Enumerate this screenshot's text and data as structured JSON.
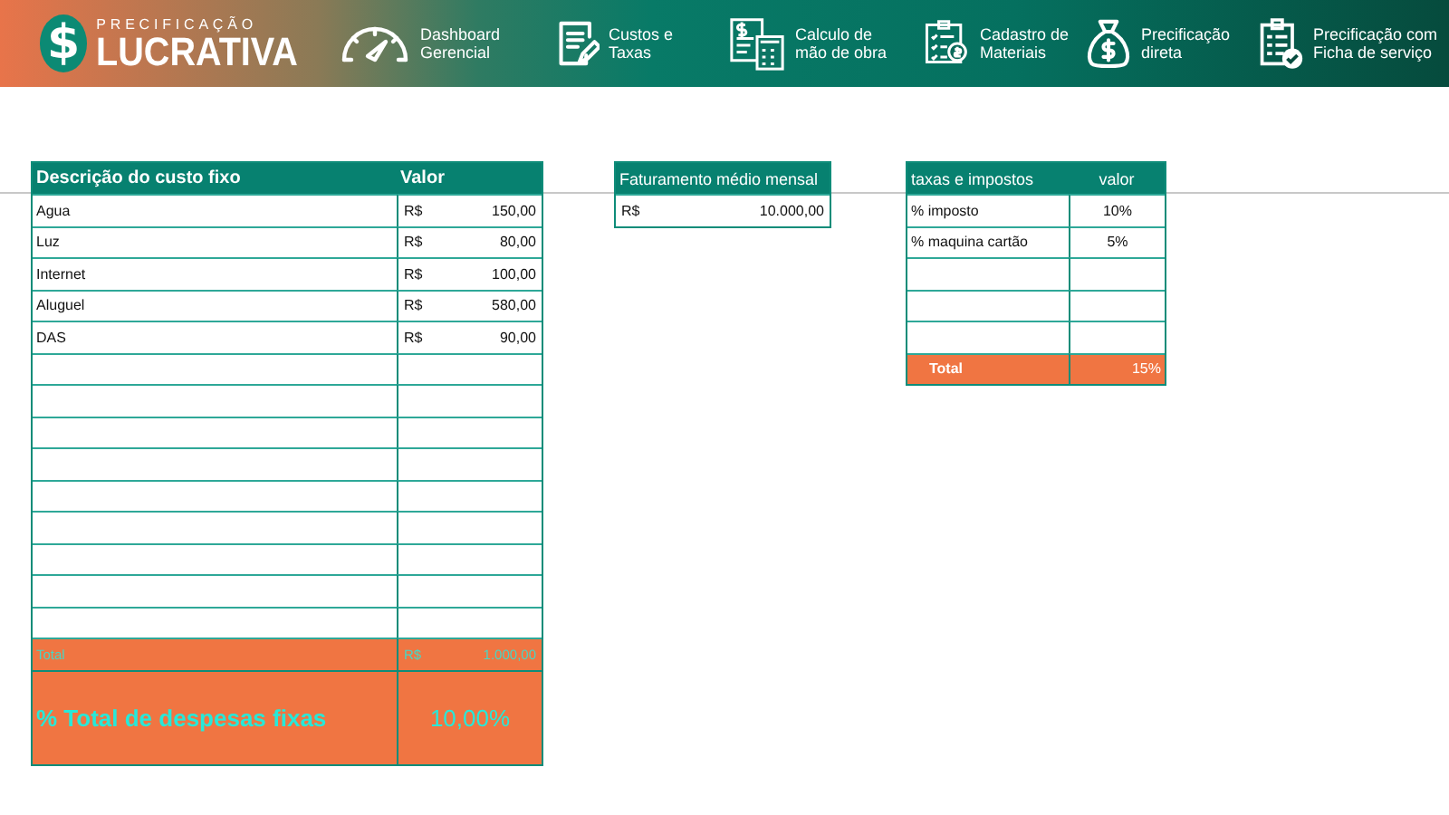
{
  "brand": {
    "symbol": "$",
    "top": "PRECIFICAÇÃO",
    "name": "LUCRATIVA"
  },
  "nav": [
    {
      "line1": "Dashboard",
      "line2": "Gerencial"
    },
    {
      "line1": "Custos e",
      "line2": "Taxas"
    },
    {
      "line1": "Calculo de",
      "line2": "mão de obra"
    },
    {
      "line1": "Cadastro de",
      "line2": "Materiais"
    },
    {
      "line1": "Precificação",
      "line2": "direta"
    },
    {
      "line1": "Precificação com",
      "line2": "Ficha de serviço"
    }
  ],
  "fixed_costs": {
    "columns": [
      "Descrição do custo fixo",
      "Valor"
    ],
    "rows": [
      {
        "description": "Agua",
        "currency": "R$",
        "value": "150,00"
      },
      {
        "description": "Luz",
        "currency": "R$",
        "value": "80,00"
      },
      {
        "description": "Internet",
        "currency": "R$",
        "value": "100,00"
      },
      {
        "description": "Aluguel",
        "currency": "R$",
        "value": "580,00"
      },
      {
        "description": "DAS",
        "currency": "R$",
        "value": "90,00"
      }
    ],
    "total": {
      "label": "Total",
      "currency": "R$",
      "value": "1.000,00"
    },
    "percent": {
      "label": "% Total de despesas fixas",
      "value": "10,00%"
    }
  },
  "revenue": {
    "title": "Faturamento médio mensal",
    "currency": "R$",
    "value": "10.000,00"
  },
  "taxes": {
    "columns": [
      "taxas e impostos",
      "valor"
    ],
    "rows": [
      {
        "label": "% imposto",
        "value": "10%"
      },
      {
        "label": "% maquina cartão",
        "value": "5%"
      }
    ],
    "total": {
      "label": "Total",
      "value": "15%"
    }
  }
}
